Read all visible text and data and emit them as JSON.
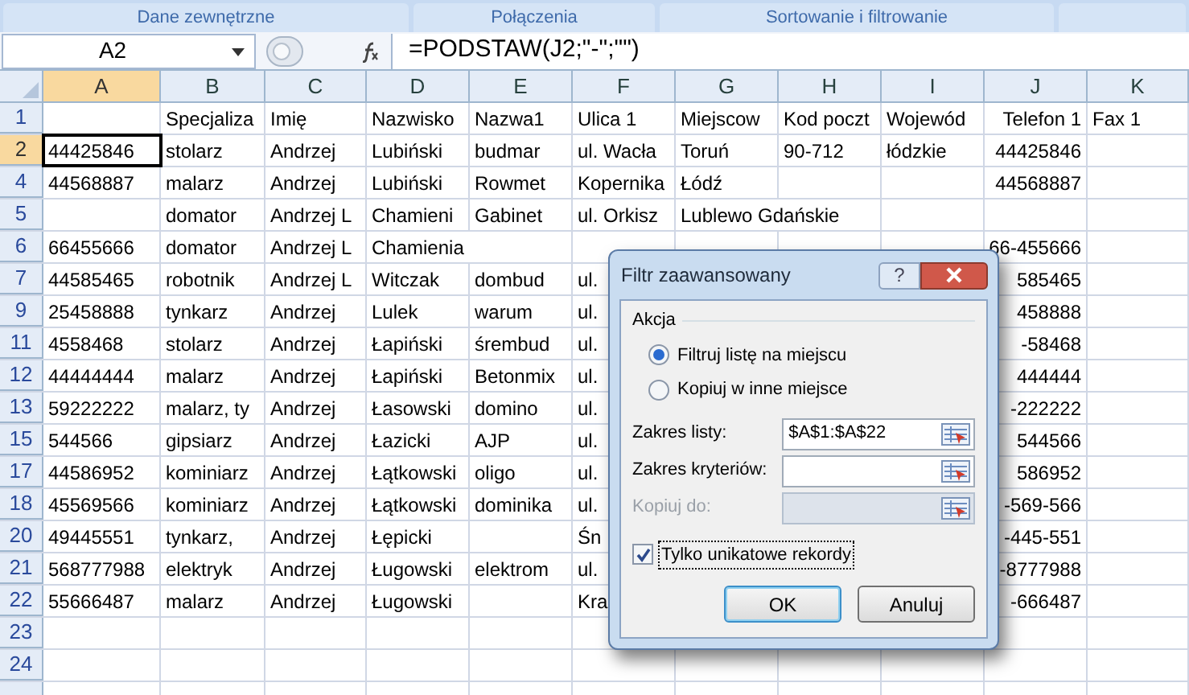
{
  "ribbon": {
    "groups": [
      "Dane zewnętrzne",
      "Połączenia",
      "Sortowanie i filtrowanie"
    ]
  },
  "formula_bar": {
    "name_box": "A2",
    "formula": "=PODSTAW(J2;\"-\";\"\")"
  },
  "columns": [
    {
      "label": "A",
      "selected": true
    },
    {
      "label": "B",
      "selected": false
    },
    {
      "label": "C",
      "selected": false
    },
    {
      "label": "D",
      "selected": false
    },
    {
      "label": "E",
      "selected": false
    },
    {
      "label": "F",
      "selected": false
    },
    {
      "label": "G",
      "selected": false
    },
    {
      "label": "H",
      "selected": false
    },
    {
      "label": "I",
      "selected": false
    },
    {
      "label": "J",
      "selected": false
    },
    {
      "label": "K",
      "selected": false
    }
  ],
  "rows": [
    {
      "label": "1",
      "selected": false,
      "cells": {
        "b": "Specjaliza",
        "c": "Imię",
        "d": "Nazwisko",
        "e": "Nazwa1",
        "f": "Ulica 1",
        "g": "Miejscow",
        "h": "Kod poczt",
        "i": "Wojewód",
        "j": "Telefon 1",
        "k": "Fax 1"
      }
    },
    {
      "label": "2",
      "selected": true,
      "cells": {
        "a": "44425846",
        "b": "stolarz",
        "c": "Andrzej",
        "d": "Lubiński",
        "e": "budmar",
        "f": "ul. Wacła",
        "g": "Toruń",
        "h": "90-712",
        "i": "łódzkie",
        "j": "44425846"
      }
    },
    {
      "label": "4",
      "selected": false,
      "cells": {
        "a": "44568887",
        "b": "malarz",
        "c": "Andrzej",
        "d": "Lubiński",
        "e": "Rowmet",
        "f": "Kopernika",
        "g": "Łódź",
        "j": "44568887"
      }
    },
    {
      "label": "5",
      "selected": false,
      "cells": {
        "b": "domator",
        "c": "Andrzej L",
        "d": "Chamieni",
        "e": "Gabinet",
        "f": "ul. Orkisz",
        "g": {
          "text": "Lublewo Gdańskie",
          "spills": true
        }
      }
    },
    {
      "label": "6",
      "selected": false,
      "cells": {
        "a": "66455666",
        "b": "domator",
        "c": "Andrzej L",
        "d": {
          "text": "Chamienia",
          "spills": true
        },
        "j": "66-455666"
      }
    },
    {
      "label": "7",
      "selected": false,
      "cells": {
        "a": "44585465",
        "b": "robotnik",
        "c": "Andrzej L",
        "d": "Witczak",
        "e": "dombud",
        "f": "ul.",
        "j": "585465"
      }
    },
    {
      "label": "9",
      "selected": false,
      "cells": {
        "a": "25458888",
        "b": "tynkarz",
        "c": "Andrzej",
        "d": "Lulek",
        "e": "warum",
        "f": "ul.",
        "j": "458888"
      }
    },
    {
      "label": "11",
      "selected": false,
      "cells": {
        "a": "4558468",
        "b": "stolarz",
        "c": "Andrzej",
        "d": "Łapiński",
        "e": "śrembud",
        "f": "ul.",
        "j": "-58468"
      }
    },
    {
      "label": "12",
      "selected": false,
      "cells": {
        "a": "44444444",
        "b": "malarz",
        "c": "Andrzej",
        "d": "Łapiński",
        "e": "Betonmix",
        "f": "ul.",
        "j": "444444"
      }
    },
    {
      "label": "13",
      "selected": false,
      "cells": {
        "a": "59222222",
        "b": "malarz, ty",
        "c": "Andrzej",
        "d": "Łasowski",
        "e": "domino",
        "f": "ul.",
        "j": "-222222"
      }
    },
    {
      "label": "15",
      "selected": false,
      "cells": {
        "a": "544566",
        "b": "gipsiarz",
        "c": "Andrzej",
        "d": "Łazicki",
        "e": "AJP",
        "f": "ul.",
        "j": "544566"
      }
    },
    {
      "label": "17",
      "selected": false,
      "cells": {
        "a": "44586952",
        "b": "kominiarz",
        "c": "Andrzej",
        "d": "Łątkowski",
        "e": "oligo",
        "f": "ul.",
        "j": "586952"
      }
    },
    {
      "label": "18",
      "selected": false,
      "cells": {
        "a": "45569566",
        "b": "kominiarz",
        "c": "Andrzej",
        "d": "Łątkowski",
        "e": "dominika",
        "f": "ul.",
        "j": "-569-566"
      }
    },
    {
      "label": "20",
      "selected": false,
      "cells": {
        "a": "49445551",
        "b": "tynkarz,",
        "c": "Andrzej",
        "d": "Łępicki",
        "f": "Śn",
        "j": "-445-551"
      }
    },
    {
      "label": "21",
      "selected": false,
      "cells": {
        "a": "568777988",
        "b": "elektryk",
        "c": "Andrzej",
        "d": "Ługowski",
        "e": "elektrom",
        "f": "ul.",
        "j": "-8777988"
      }
    },
    {
      "label": "22",
      "selected": false,
      "cells": {
        "a": "55666487",
        "b": "malarz",
        "c": "Andrzej",
        "d": "Ługowski",
        "f": "Kra",
        "j": "-666487"
      }
    },
    {
      "label": "23",
      "selected": false,
      "cells": {}
    },
    {
      "label": "24",
      "selected": false,
      "cells": {}
    }
  ],
  "dialog": {
    "title": "Filtr zaawansowany",
    "help": "?",
    "group": "Akcja",
    "radios": [
      {
        "label": "Filtruj listę na miejscu",
        "selected": true
      },
      {
        "label": "Kopiuj w inne miejsce",
        "selected": false
      }
    ],
    "fields": [
      {
        "label": "Zakres listy:",
        "value": "$A$1:$A$22",
        "disabled": false
      },
      {
        "label": "Zakres kryteriów:",
        "disabled": false
      },
      {
        "label": "Kopiuj do:",
        "disabled": true
      }
    ],
    "checkbox": {
      "label": "Tylko unikatowe rekordy",
      "checked": true
    },
    "buttons": [
      "OK",
      "Anuluj"
    ]
  }
}
